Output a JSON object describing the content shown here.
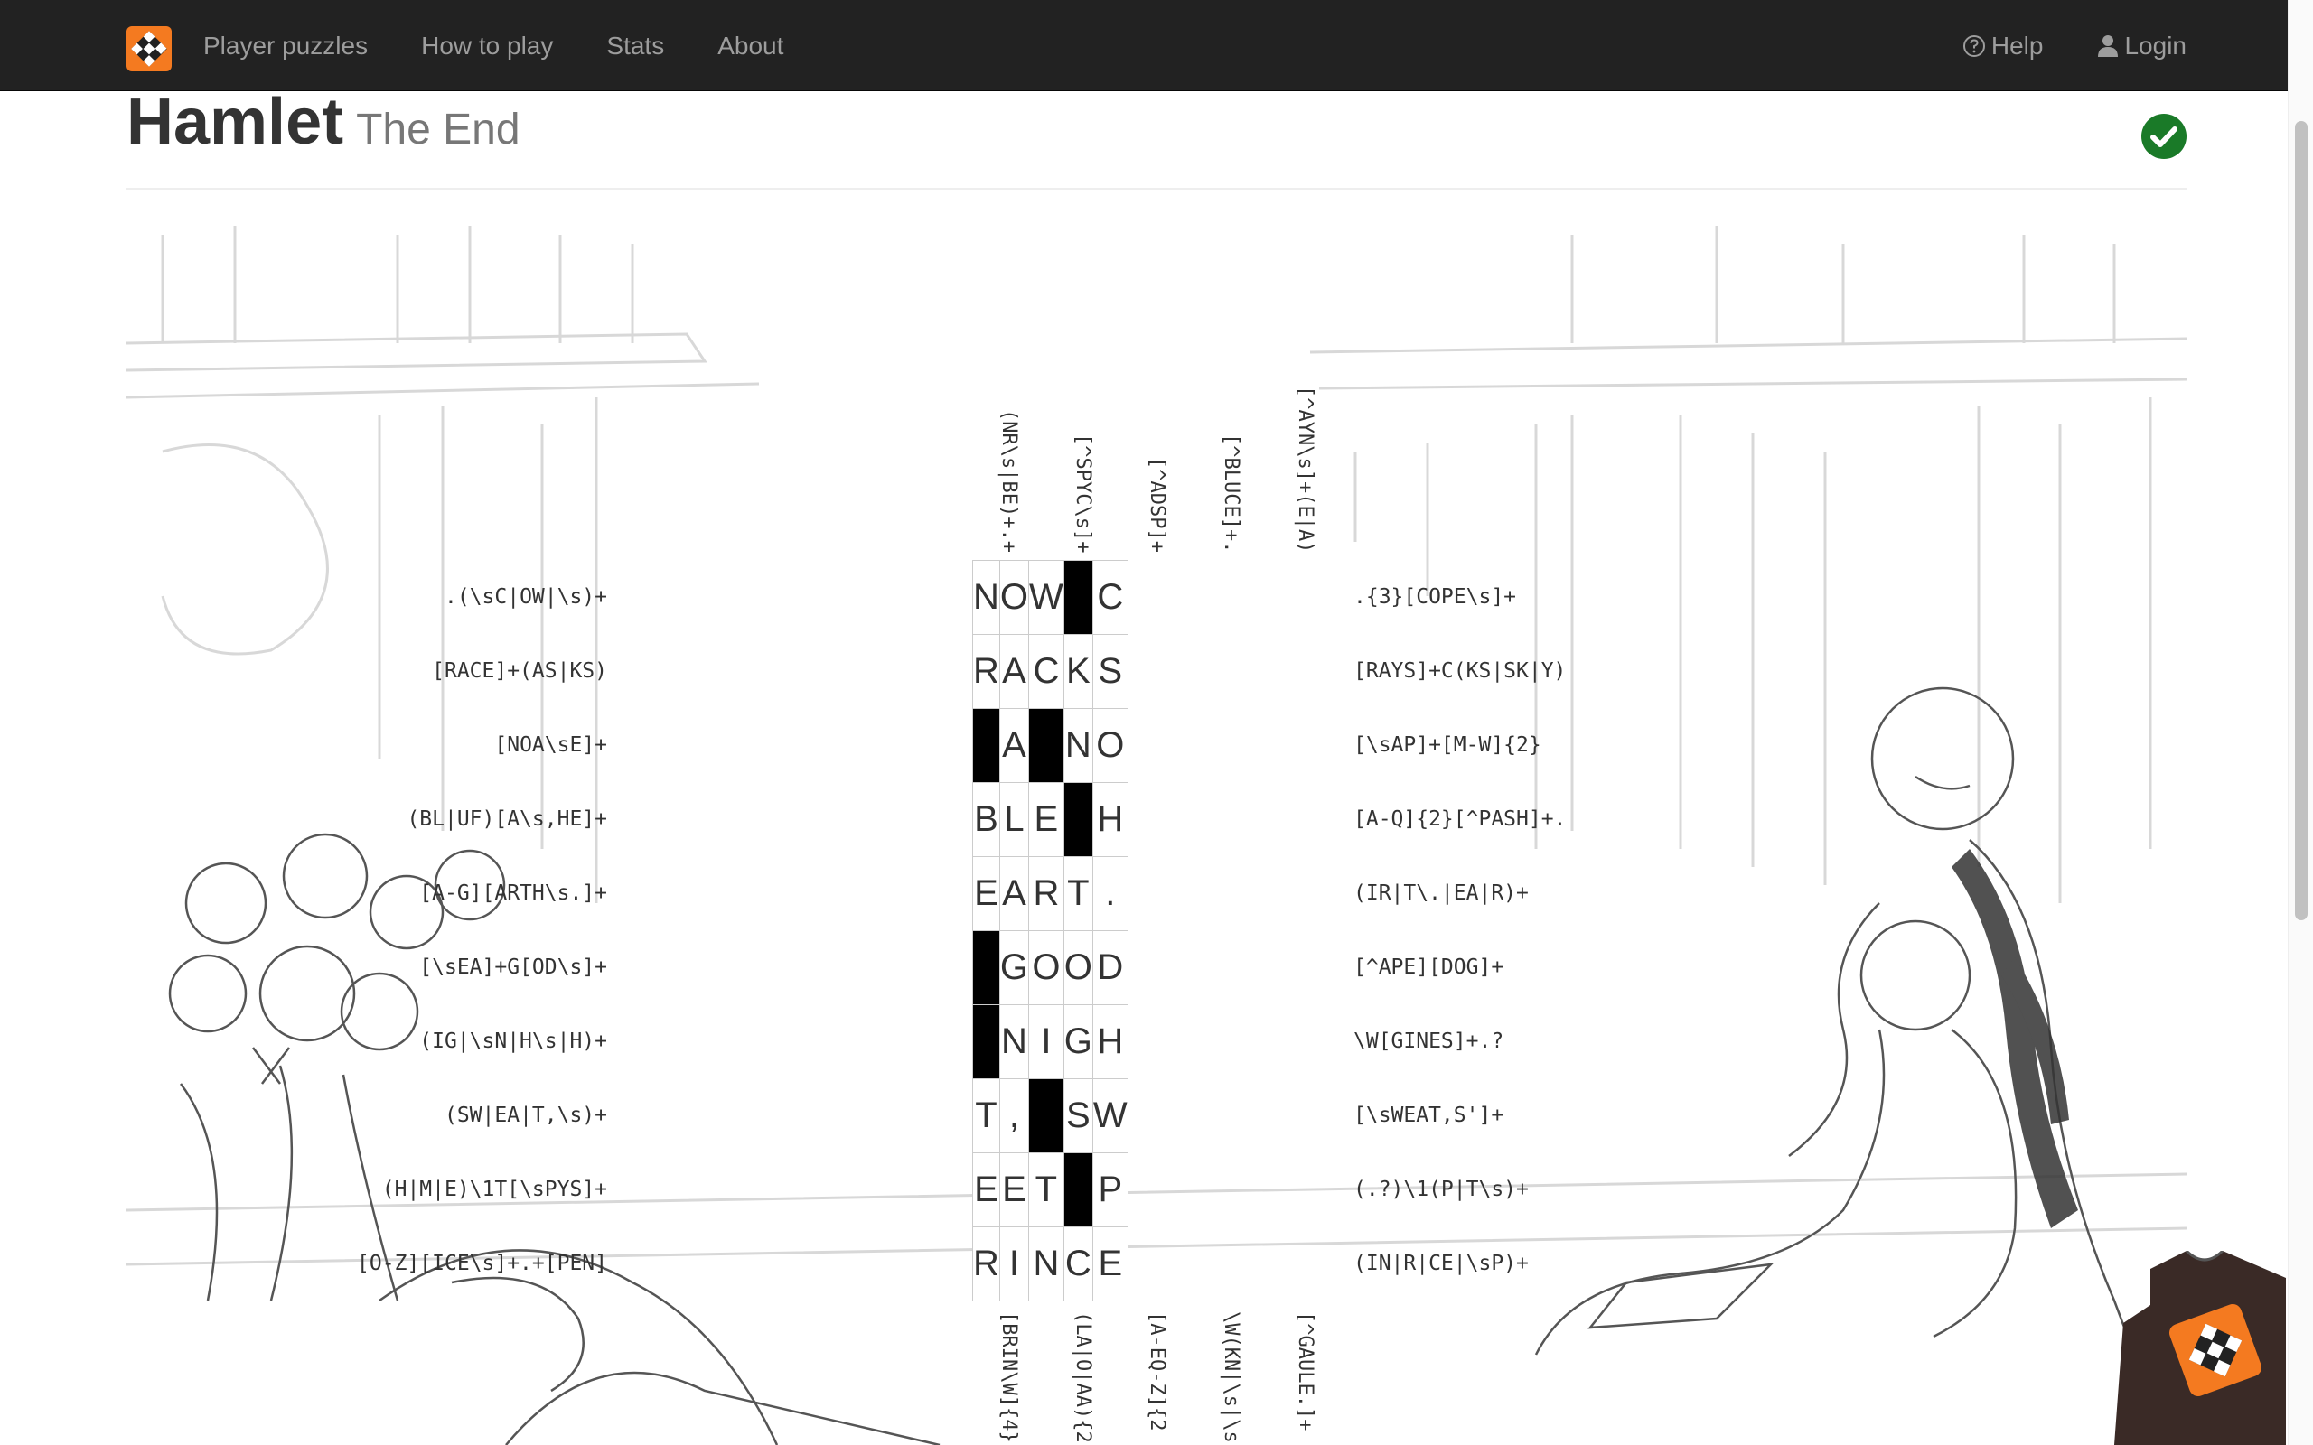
{
  "nav": {
    "items": [
      "Player puzzles",
      "How to play",
      "Stats",
      "About"
    ],
    "help": "Help",
    "login": "Login"
  },
  "header": {
    "title": "Hamlet",
    "subtitle": "The End"
  },
  "puzzle": {
    "columns_top": [
      "(NR\\s|BE)+.+",
      "[^SPYC\\s]+",
      "[^ADSP]+",
      "[^BLUCE]+.",
      "[^AYN\\s]+(E|A)"
    ],
    "columns_bottom": [
      "[BRIN\\W]{4}",
      "(LA|O|AA){2",
      "[A-EQ-Z]{2",
      "\\W(KN|\\s|\\s",
      "[^GAULE.]+"
    ],
    "rows_left": [
      ".(\\sC|OW|\\s)+",
      "[RACE]+(AS|KS)",
      "[NOA\\sE]+",
      "(BL|UF)[A\\s,HE]+",
      "[A-G][ARTH\\s.]+",
      "[\\sEA]+G[OD\\s]+",
      "(IG|\\sN|H\\s|H)+",
      "(SW|EA|T,\\s)+",
      "(H|M|E)\\1T[\\sPYS]+",
      "[O-Z][ICE\\s]+.+[PEN]"
    ],
    "rows_right": [
      ".{3}[COPE\\s]+",
      "[RAYS]+C(KS|SK|Y)",
      "[\\sAP]+[M-W]{2}",
      "[A-Q]{2}[^PASH]+.",
      "(IR|T\\.|EA|R)+",
      "[^APE][DOG]+",
      "\\W[GINES]+.?",
      "[\\sWEAT,S']+",
      "(.?)\\1(P|T\\s)+",
      "(IN|R|CE|\\sP)+"
    ],
    "grid": [
      [
        "N",
        "O",
        "W",
        "#",
        "C"
      ],
      [
        "R",
        "A",
        "C",
        "K",
        "S"
      ],
      [
        "#",
        "A",
        "#",
        "N",
        "O"
      ],
      [
        "B",
        "L",
        "E",
        "#",
        "H"
      ],
      [
        "E",
        "A",
        "R",
        "T",
        "."
      ],
      [
        "#",
        "G",
        "O",
        "O",
        "D"
      ],
      [
        "#",
        "N",
        "I",
        "G",
        "H"
      ],
      [
        "T",
        ",",
        "#",
        "S",
        "W"
      ],
      [
        "E",
        "E",
        "T",
        "#",
        "P"
      ],
      [
        "R",
        "I",
        "N",
        "C",
        "E"
      ]
    ]
  },
  "colors": {
    "navbar": "#222222",
    "nav_text": "#9d9d9d",
    "solved": "#1a7a28",
    "brand": "#f47a20"
  },
  "icons": {
    "help": "question-circle-icon",
    "login": "user-icon",
    "solved": "check-circle-icon"
  }
}
